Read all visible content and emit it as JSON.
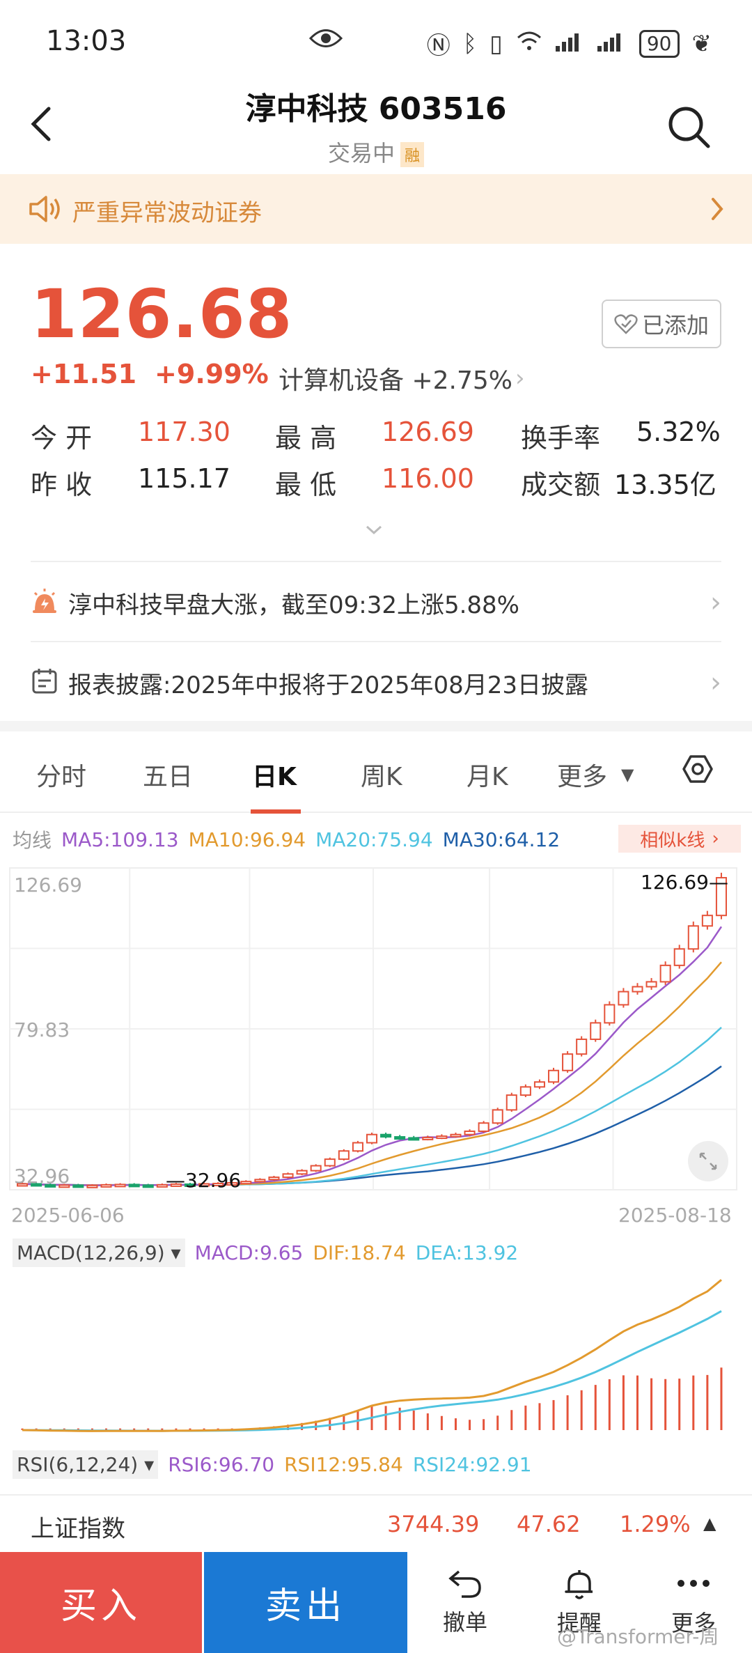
{
  "status_bar": {
    "time": "13:03",
    "battery": "90"
  },
  "header": {
    "title": "淳中科技 603516",
    "subtitle": "交易中",
    "badge": "融"
  },
  "banner": {
    "text": "严重异常波动证券"
  },
  "quote": {
    "price": "126.68",
    "change": "+11.51",
    "change_pct": "+9.99%",
    "sector": "计算机设备 +2.75%",
    "added_label": "已添加",
    "stats": {
      "open_label": "今 开",
      "open": "117.30",
      "high_label": "最 高",
      "high": "126.69",
      "turnover_label": "换手率",
      "turnover": "5.32%",
      "prev_label": "昨 收",
      "prev": "115.17",
      "low_label": "最 低",
      "low": "116.00",
      "amount_label": "成交额",
      "amount": "13.35亿"
    }
  },
  "news": [
    {
      "text": "淳中科技早盘大涨，截至09:32上涨5.88%"
    },
    {
      "text": "报表披露:2025年中报将于2025年08月23日披露"
    }
  ],
  "tabs": [
    "分时",
    "五日",
    "日K",
    "周K",
    "月K",
    "更多"
  ],
  "active_tab": "日K",
  "ma": {
    "label": "均线",
    "ma5": "MA5:109.13",
    "ma10": "MA10:96.94",
    "ma20": "MA20:75.94",
    "ma30": "MA30:64.12",
    "similar": "相似k线"
  },
  "kline": {
    "y_top": "126.69",
    "y_mid": "79.83",
    "y_bot": "32.96",
    "max_marker": "126.69",
    "min_marker": "32.96",
    "date_start": "2025-06-06",
    "date_end": "2025-08-18"
  },
  "macd": {
    "label": "MACD(12,26,9)",
    "macd": "MACD:9.65",
    "dif": "DIF:18.74",
    "dea": "DEA:13.92"
  },
  "rsi": {
    "label": "RSI(6,12,24)",
    "rsi6": "RSI6:96.70",
    "rsi12": "RSI12:95.84",
    "rsi24": "RSI24:92.91"
  },
  "index_bar": {
    "name": "上证指数",
    "value": "3744.39",
    "change": "47.62",
    "pct": "1.29%"
  },
  "bottom": {
    "buy": "买入",
    "sell": "卖出",
    "cancel": "撤单",
    "remind": "提醒",
    "more": "更多"
  },
  "watermark": "@Transformer-周",
  "colors": {
    "red": "#e5533a",
    "green": "#1aa36b",
    "ma5": "#9b59c9",
    "ma10": "#e29a2e",
    "ma20": "#4fc3e0",
    "ma30": "#1f5fa8",
    "buy": "#e8514a",
    "sell": "#1b79d4"
  },
  "chart_data": {
    "type": "candlestick",
    "y_range": [
      32.96,
      126.69
    ],
    "x_range": [
      "2025-06-06",
      "2025-08-18"
    ],
    "closes_approx": [
      33.5,
      33.2,
      33.0,
      33.1,
      32.9,
      33.0,
      33.2,
      33.3,
      33.1,
      33.0,
      33.2,
      33.4,
      33.3,
      33.5,
      33.6,
      33.8,
      34.2,
      34.8,
      35.5,
      36.5,
      37.5,
      39.0,
      41.0,
      43.5,
      46.0,
      48.5,
      47.8,
      47.5,
      47.2,
      47.6,
      48.0,
      48.5,
      49.5,
      52.0,
      56.0,
      60.5,
      63.0,
      64.5,
      68.0,
      73.0,
      77.5,
      82.5,
      88.0,
      92.0,
      93.5,
      95.0,
      100.0,
      105.0,
      112.0,
      115.2,
      126.68
    ]
  }
}
